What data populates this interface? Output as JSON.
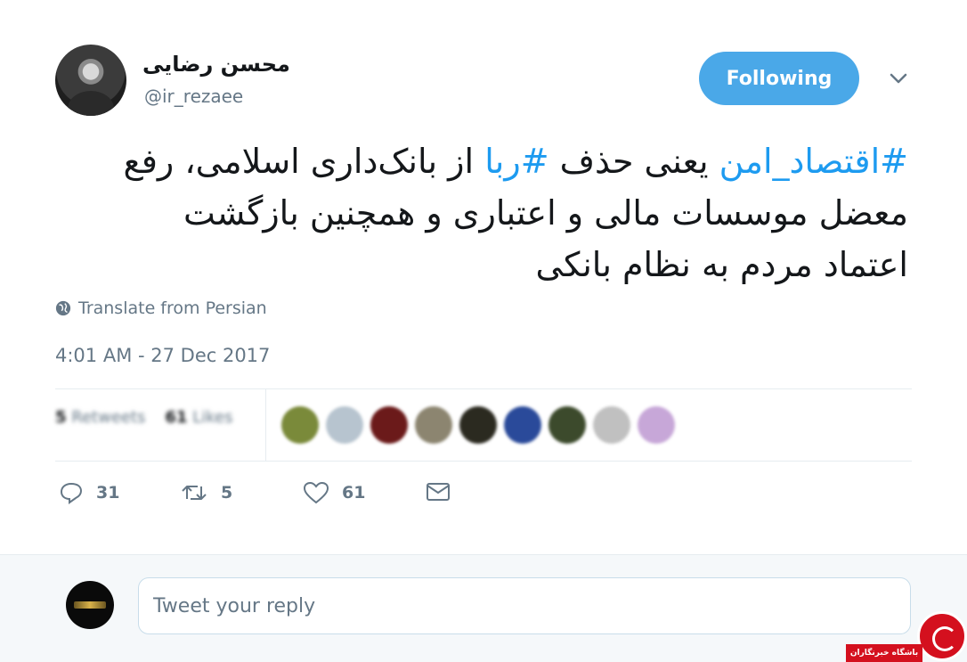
{
  "author": {
    "display_name": "محسن رضایی",
    "handle": "@ir_rezaee"
  },
  "follow_button": {
    "label": "Following"
  },
  "tweet": {
    "hashtag_1": "#اقتصاد_امن",
    "text_part_1": " یعنی حذف ",
    "hashtag_2": "#ربا",
    "text_part_2": " از بانک‌داری اسلامی، رفع معضل موسسات مالی و اعتباری و همچنین بازگشت اعتماد مردم به نظام بانکی"
  },
  "translate_link": "Translate from Persian",
  "timestamp": "4:01 AM - 27 Dec 2017",
  "stats": {
    "retweets_count": "5",
    "retweets_label": "Retweets",
    "likes_count": "61",
    "likes_label": "Likes"
  },
  "likers": [
    {
      "color": "#7a8a3a"
    },
    {
      "color": "#b7c4cf"
    },
    {
      "color": "#6b1a1a"
    },
    {
      "color": "#8c8570"
    },
    {
      "color": "#2b2a20"
    },
    {
      "color": "#2a4a9a"
    },
    {
      "color": "#3c4a2c"
    },
    {
      "color": "#c0c0c0"
    },
    {
      "color": "#c7a7d8"
    }
  ],
  "actions": {
    "reply_count": "31",
    "retweet_count": "5",
    "like_count": "61"
  },
  "reply": {
    "placeholder": "Tweet your reply"
  },
  "watermark": {
    "text": "باشگاه خبرنگاران"
  },
  "colors": {
    "accent": "#1d9bf0",
    "follow_bg": "#4aa8e8",
    "muted": "#657786",
    "watermark_red": "#d4101e"
  }
}
